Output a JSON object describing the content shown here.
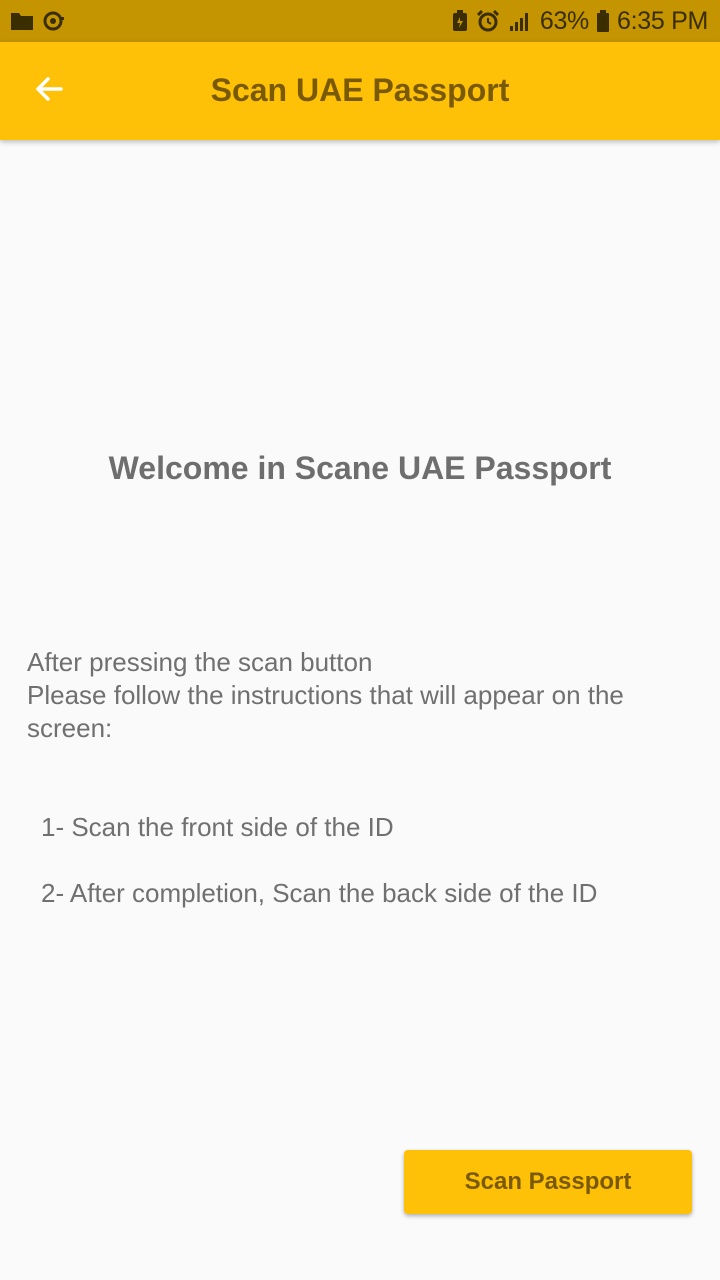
{
  "status_bar": {
    "battery": "63%",
    "time": "6:35 PM",
    "icons": [
      "folder-icon",
      "sync-icon",
      "battery-saver-icon",
      "alarm-icon",
      "signal-icon",
      "battery-icon"
    ]
  },
  "app_bar": {
    "title": "Scan UAE Passport",
    "back_icon": "arrow-back-icon",
    "color": "#ffc107"
  },
  "main": {
    "welcome": "Welcome in Scane UAE Passport",
    "intro_line1": "After pressing the scan button",
    "intro_line2": "Please follow the instructions that will appear on the screen:",
    "steps": [
      "1- Scan the front side of the ID",
      "2- After completion, Scan the back side of the ID"
    ]
  },
  "actions": {
    "scan_label": "Scan Passport"
  },
  "colors": {
    "accent": "#ffc107",
    "status_bar": "#c49500",
    "accent_text": "#7a5a00",
    "body_text": "#707070"
  }
}
